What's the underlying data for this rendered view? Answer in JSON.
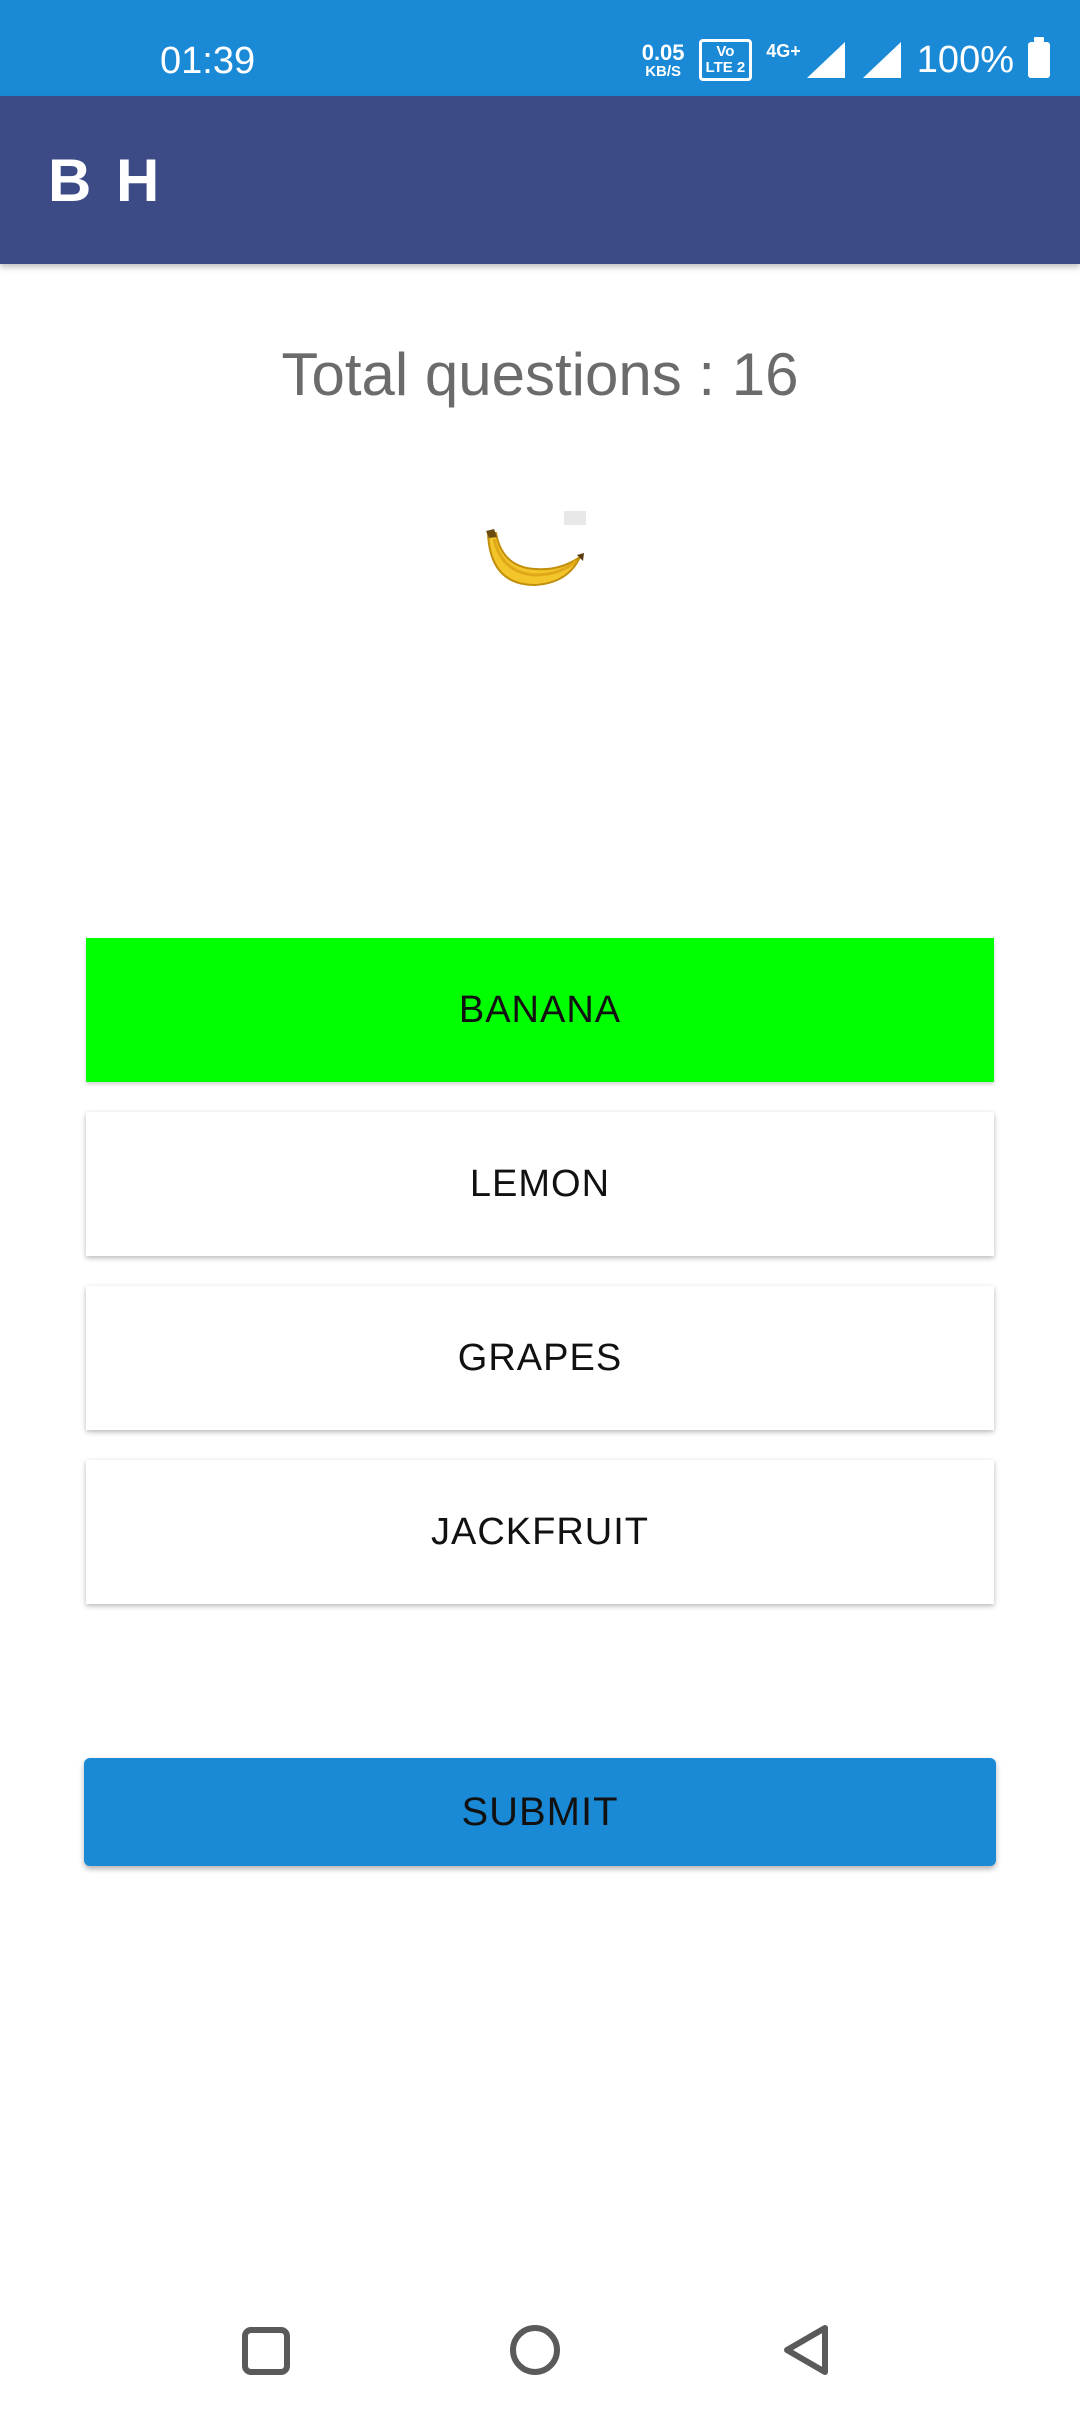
{
  "status_bar": {
    "time": "01:39",
    "net_speed_value": "0.05",
    "net_speed_unit": "KB/S",
    "volte_line1": "Vo",
    "volte_line2": "LTE 2",
    "network_type": "4G+",
    "battery": "100%",
    "icons": [
      "signal-icon",
      "signal-icon",
      "battery-icon"
    ]
  },
  "app_bar": {
    "title": "B H"
  },
  "quiz": {
    "total_questions_label": "Total questions : 16",
    "image": "banana-image",
    "options": [
      {
        "label": "BANANA",
        "selected": true
      },
      {
        "label": "LEMON",
        "selected": false
      },
      {
        "label": "GRAPES",
        "selected": false
      },
      {
        "label": "JACKFRUIT",
        "selected": false
      }
    ],
    "submit_label": "SUBMIT"
  },
  "colors": {
    "status_bar": "#1a8ad6",
    "app_bar": "#3c4a85",
    "selected_option": "#00ff00",
    "submit_button": "#1a8ad6"
  },
  "nav_bar": {
    "icons": [
      "recent-apps-icon",
      "home-icon",
      "back-icon"
    ]
  }
}
